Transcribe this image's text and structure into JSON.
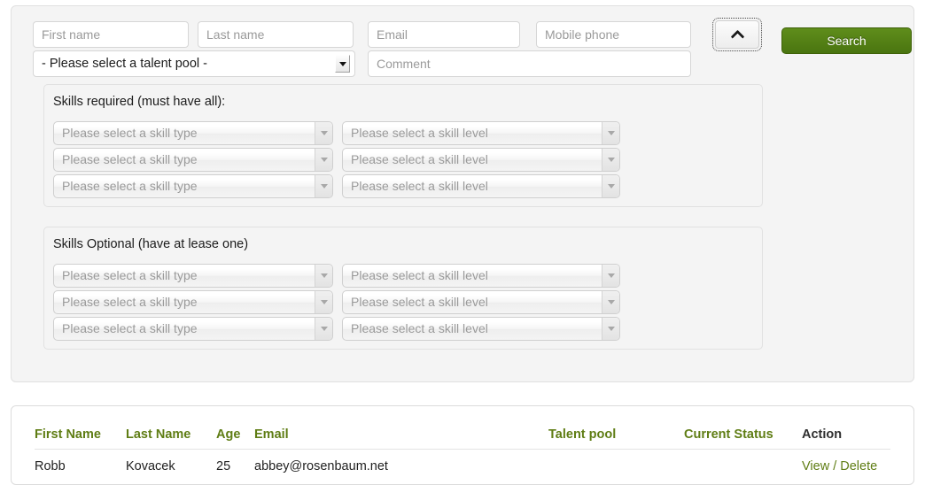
{
  "search_panel": {
    "inputs": {
      "first_name_placeholder": "First name",
      "last_name_placeholder": "Last name",
      "email_placeholder": "Email",
      "mobile_placeholder": "Mobile phone",
      "comment_placeholder": "Comment"
    },
    "talent_pool_select": {
      "selected": "- Please select a talent pool -"
    },
    "toggle_button": {
      "icon": "chevron-up-icon"
    },
    "search_button": {
      "label": "Search",
      "color": "#4a7510"
    },
    "skills_required": {
      "legend": "Skills required (must have all):",
      "rows": [
        {
          "type": "Please select a skill type",
          "level": "Please select a skill level"
        },
        {
          "type": "Please select a skill type",
          "level": "Please select a skill level"
        },
        {
          "type": "Please select a skill type",
          "level": "Please select a skill level"
        }
      ]
    },
    "skills_optional": {
      "legend": "Skills Optional (have at lease one)",
      "rows": [
        {
          "type": "Please select a skill type",
          "level": "Please select a skill level"
        },
        {
          "type": "Please select a skill type",
          "level": "Please select a skill level"
        },
        {
          "type": "Please select a skill type",
          "level": "Please select a skill level"
        }
      ]
    }
  },
  "results": {
    "headers": {
      "first_name": "First Name",
      "last_name": "Last Name",
      "age": "Age",
      "email": "Email",
      "talent_pool": "Talent pool",
      "current_status": "Current Status",
      "action": "Action"
    },
    "header_color": "#5f7d14",
    "rows": [
      {
        "first_name": "Robb",
        "last_name": "Kovacek",
        "age": "25",
        "email": "abbey@rosenbaum.net",
        "talent_pool": "",
        "current_status": "",
        "action_view": "View",
        "action_separator": "/",
        "action_delete": "Delete"
      }
    ]
  }
}
